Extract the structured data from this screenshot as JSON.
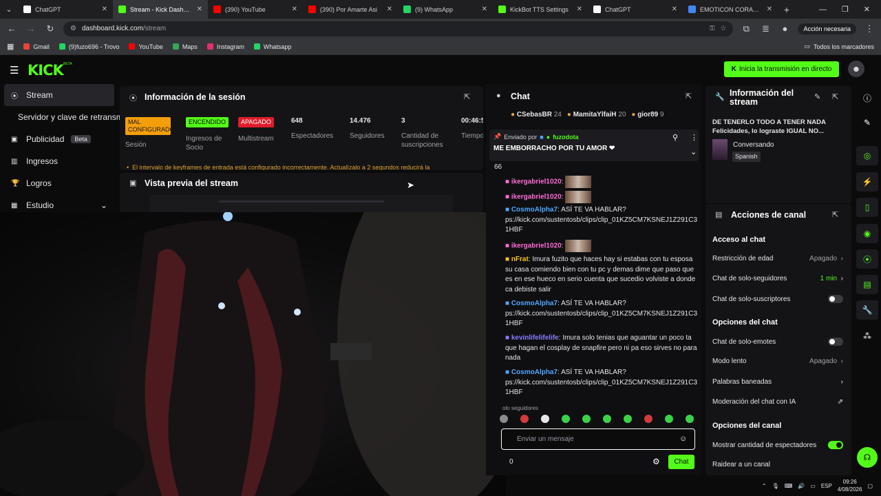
{
  "browser": {
    "tabs": [
      {
        "label": "ChatGPT",
        "icon": "chatgpt-icon",
        "color": "#ffffff"
      },
      {
        "label": "Stream - Kick Dashboard",
        "icon": "kick-icon",
        "color": "#53fc18",
        "active": true
      },
      {
        "label": "(390) YouTube",
        "icon": "youtube-icon",
        "color": "#ff0000"
      },
      {
        "label": "(390) Por Amarte Asi",
        "icon": "youtube-icon",
        "color": "#ff0000"
      },
      {
        "label": "(9) WhatsApp",
        "icon": "whatsapp-icon",
        "color": "#25d366"
      },
      {
        "label": "KickBot TTS Settings",
        "icon": "kick-icon",
        "color": "#53fc18"
      },
      {
        "label": "ChatGPT",
        "icon": "chatgpt-icon",
        "color": "#ffffff"
      },
      {
        "label": "EMOTICON CORAZON N",
        "icon": "google-icon",
        "color": "#4285f4"
      }
    ],
    "url_host": "dashboard.kick.com",
    "url_path": "/stream",
    "action_pill": "Acción necesaria",
    "bookmarks": [
      {
        "label": "Gmail",
        "color": "#ea4335"
      },
      {
        "label": "(9)fuzo696 - Trovo",
        "color": "#1ed760"
      },
      {
        "label": "YouTube",
        "color": "#ff0000"
      },
      {
        "label": "Maps",
        "color": "#34a853"
      },
      {
        "label": "Instagram",
        "color": "#e1306c"
      },
      {
        "label": "Whatsapp",
        "color": "#25d366"
      }
    ],
    "all_bookmarks": "Todos los marcadores"
  },
  "kick": {
    "logo": "KICK",
    "beta": "BETA",
    "go_live": "Inicia la transmisión en directo",
    "accent": "#53fc18"
  },
  "sidebar": {
    "items": [
      {
        "label": "Stream",
        "icon": "broadcast-icon",
        "active": true
      },
      {
        "label": "Servidor y clave de retransm",
        "icon": ""
      },
      {
        "label": "Publicidad",
        "icon": "ad-icon",
        "badge": "Beta"
      },
      {
        "label": "Ingresos",
        "icon": "chart-icon"
      },
      {
        "label": "Logros",
        "icon": "trophy-icon"
      },
      {
        "label": "Estudio",
        "icon": "studio-icon"
      }
    ]
  },
  "session": {
    "title": "Información de la sesión",
    "stats": [
      {
        "value": "MAL CONFIGURADO",
        "label": "Sesión",
        "kind": "tag",
        "bg": "#f59e0b",
        "fg": "#1a1a1a"
      },
      {
        "value": "ENCENDIDO",
        "label": "Ingresos de Socio",
        "kind": "tag",
        "bg": "#53fc18",
        "fg": "#0b0b0c"
      },
      {
        "value": "APAGADO",
        "label": "Multistream",
        "kind": "tag",
        "bg": "#e11d2a",
        "fg": "#ffffff"
      },
      {
        "value": "648",
        "label": "Espectadores"
      },
      {
        "value": "14.476",
        "label": "Seguidores"
      },
      {
        "value": "3",
        "label": "Cantidad de suscripciones"
      },
      {
        "value": "00:46:5",
        "label": "Tiempo en vivo"
      }
    ],
    "warning": "El intervalo de keyframes de entrada está configurado incorrectamente. Actualízalo a 2 segundos reducirá la"
  },
  "preview": {
    "title": "Vista previa del stream"
  },
  "chat": {
    "title": "Chat",
    "top_gifters": [
      {
        "name": "CSebasBR",
        "count": "24"
      },
      {
        "name": "MamitaYlfaiH",
        "count": "20"
      },
      {
        "name": "gior89",
        "count": "9"
      }
    ],
    "pinned_by_label": "Enviado por",
    "pinned_user": "fuzodota",
    "pinned_message": "ME EMBORRACHO POR TU AMOR ❤",
    "messages": [
      {
        "user": "",
        "text": "66"
      },
      {
        "user": "ikergabriel1020",
        "text": "",
        "user_color": "#ff6ad5"
      },
      {
        "user": "ikergabriel1020",
        "text": "",
        "user_color": "#ff6ad5"
      },
      {
        "user": "CosmoAlpha7",
        "text": "ASÍ TE VA HABLAR? ps://kick.com/sustentosb/clips/clip_01KZ5CM7KSNEJ1Z291C3 1HBF",
        "user_color": "#4ea8ff"
      },
      {
        "user": "ikergabriel1020",
        "text": "",
        "user_color": "#ff6ad5"
      },
      {
        "user": "nFrat",
        "text": "Imura fuzito que haces hay si estabas con tu esposa su casa comiendo bien con tu pc y demas dime que paso que es en ese hueco en serio cuenta que sucedio volviste a donde ca debiste salir",
        "user_color": "#f5c518"
      },
      {
        "user": "CosmoAlpha7",
        "text": "ASÍ TE VA HABLAR? ps://kick.com/sustentosb/clips/clip_01KZ5CM7KSNEJ1Z291C3 1HBF",
        "user_color": "#4ea8ff"
      },
      {
        "user": "kevinlifelifelife",
        "text": "Imura solo tenias que aguantar un poco ta que hagan el cosplay de snapfire pero ni pa eso sirves no para nada",
        "user_color": "#8a7dff"
      },
      {
        "user": "CosmoAlpha7",
        "text": "ASÍ TE VA HABLAR? ps://kick.com/sustentosb/clips/clip_01KZ5CM7KSNEJ1Z291C3 1HBF",
        "user_color": "#4ea8ff"
      }
    ],
    "mode_label": "olo seguidores",
    "input_placeholder": "Enviar un mensaje",
    "counter": "0",
    "send_label": "Chat"
  },
  "stream_info": {
    "title": "Información del stream",
    "stream_title": "DE TENERLO TODO A TENER NADA Felicidades, lo lograste IGUAL NO...",
    "category": "Conversando",
    "language": "Spanish"
  },
  "channel_actions": {
    "title": "Acciones de canal",
    "chat_access_title": "Acceso al chat",
    "age_restriction": {
      "label": "Restricción de edad",
      "value": "Apagado"
    },
    "followers_only": {
      "label": "Chat de solo-seguidores",
      "value": "1 min"
    },
    "subs_only": {
      "label": "Chat de solo-suscriptores",
      "on": false
    },
    "chat_options_title": "Opciones del chat",
    "emotes_only": {
      "label": "Chat de solo-emotes",
      "on": false
    },
    "slow_mode": {
      "label": "Modo lento",
      "value": "Apagado"
    },
    "banned_words": {
      "label": "Palabras baneadas"
    },
    "ai_moderation": {
      "label": "Moderación del chat con IA"
    },
    "channel_options_title": "Opciones del canal",
    "show_viewers": {
      "label": "Mostrar cantidad de espectadores",
      "on": true
    },
    "raid": {
      "label": "Raidear a un canal"
    }
  },
  "taskbar": {
    "lang": "ESP",
    "time": "09:26",
    "date": "4/08/2026"
  }
}
